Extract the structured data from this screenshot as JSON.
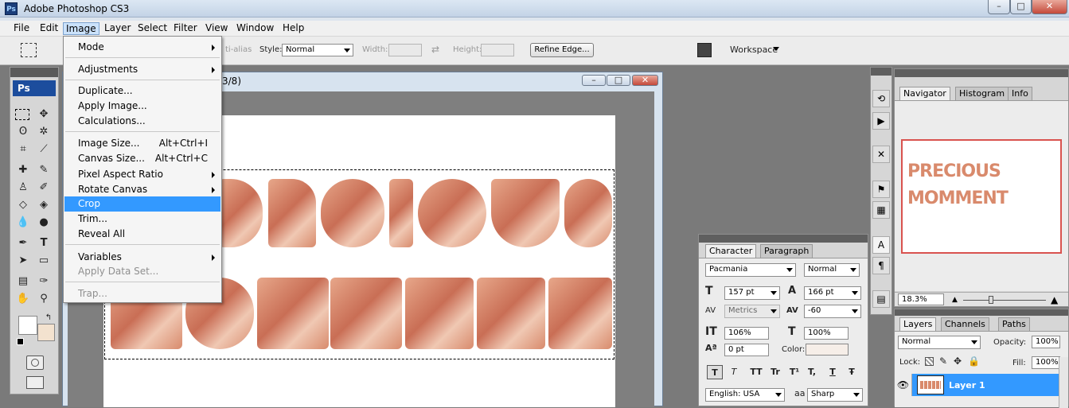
{
  "window": {
    "title": "Adobe Photoshop CS3",
    "ps_badge": "Ps",
    "controls": [
      "–",
      "□",
      "✕"
    ]
  },
  "menubar": [
    "File",
    "Edit",
    "Image",
    "Layer",
    "Select",
    "Filter",
    "View",
    "Window",
    "Help"
  ],
  "options": {
    "anti_alias": "ti-alias",
    "style_label": "Style:",
    "style_value": "Normal",
    "width_label": "Width:",
    "height_label": "Height:",
    "refine_edge": "Refine Edge...",
    "workspace": "Workspace"
  },
  "toolbox": {
    "logo": "Ps"
  },
  "document": {
    "title_fragment": "3/8)"
  },
  "image_menu": [
    {
      "label": "Mode",
      "submenu": true
    },
    {
      "label": "Adjustments",
      "submenu": true
    },
    {
      "label": "Duplicate..."
    },
    {
      "label": "Apply Image..."
    },
    {
      "label": "Calculations..."
    },
    {
      "label": "Image Size...",
      "shortcut": "Alt+Ctrl+I"
    },
    {
      "label": "Canvas Size...",
      "shortcut": "Alt+Ctrl+C"
    },
    {
      "label": "Pixel Aspect Ratio",
      "submenu": true
    },
    {
      "label": "Rotate Canvas",
      "submenu": true
    },
    {
      "label": "Crop",
      "highlighted": true
    },
    {
      "label": "Trim..."
    },
    {
      "label": "Reveal All"
    },
    {
      "label": "Variables",
      "submenu": true
    },
    {
      "label": "Apply Data Set...",
      "disabled": true
    },
    {
      "label": "Trap...",
      "disabled": true
    }
  ],
  "character": {
    "tab_character": "Character",
    "tab_paragraph": "Paragraph",
    "font": "Pacmania",
    "style": "Normal",
    "size": "157 pt",
    "leading": "166 pt",
    "kerning": "Metrics",
    "tracking": "-60",
    "vscale": "106%",
    "hscale": "100%",
    "baseline": "0 pt",
    "color_label": "Color:",
    "language": "English: USA",
    "aa_label": "a",
    "antialias": "Sharp",
    "styles": [
      "T",
      "T",
      "TT",
      "Tr",
      "T¹",
      "T,",
      "T",
      "Ŧ"
    ]
  },
  "navigator": {
    "tabs": [
      "Navigator",
      "Histogram",
      "Info"
    ],
    "zoom": "18.3%",
    "text_top": "PRECIOUS",
    "text_bottom": "MOMMENT"
  },
  "layers": {
    "tabs": [
      "Layers",
      "Channels",
      "Paths"
    ],
    "blend": "Normal",
    "opacity_label": "Opacity:",
    "opacity": "100%",
    "lock_label": "Lock:",
    "fill_label": "Fill:",
    "fill": "100%",
    "layer_name": "Layer 1"
  }
}
